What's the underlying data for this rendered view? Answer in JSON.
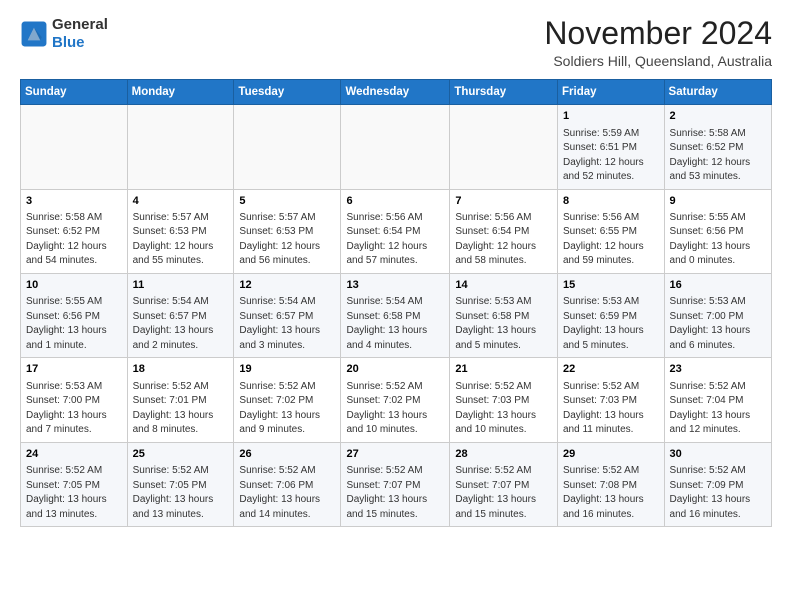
{
  "header": {
    "logo_line1": "General",
    "logo_line2": "Blue",
    "title": "November 2024",
    "subtitle": "Soldiers Hill, Queensland, Australia"
  },
  "weekdays": [
    "Sunday",
    "Monday",
    "Tuesday",
    "Wednesday",
    "Thursday",
    "Friday",
    "Saturday"
  ],
  "weeks": [
    [
      {
        "day": "",
        "info": ""
      },
      {
        "day": "",
        "info": ""
      },
      {
        "day": "",
        "info": ""
      },
      {
        "day": "",
        "info": ""
      },
      {
        "day": "",
        "info": ""
      },
      {
        "day": "1",
        "info": "Sunrise: 5:59 AM\nSunset: 6:51 PM\nDaylight: 12 hours\nand 52 minutes."
      },
      {
        "day": "2",
        "info": "Sunrise: 5:58 AM\nSunset: 6:52 PM\nDaylight: 12 hours\nand 53 minutes."
      }
    ],
    [
      {
        "day": "3",
        "info": "Sunrise: 5:58 AM\nSunset: 6:52 PM\nDaylight: 12 hours\nand 54 minutes."
      },
      {
        "day": "4",
        "info": "Sunrise: 5:57 AM\nSunset: 6:53 PM\nDaylight: 12 hours\nand 55 minutes."
      },
      {
        "day": "5",
        "info": "Sunrise: 5:57 AM\nSunset: 6:53 PM\nDaylight: 12 hours\nand 56 minutes."
      },
      {
        "day": "6",
        "info": "Sunrise: 5:56 AM\nSunset: 6:54 PM\nDaylight: 12 hours\nand 57 minutes."
      },
      {
        "day": "7",
        "info": "Sunrise: 5:56 AM\nSunset: 6:54 PM\nDaylight: 12 hours\nand 58 minutes."
      },
      {
        "day": "8",
        "info": "Sunrise: 5:56 AM\nSunset: 6:55 PM\nDaylight: 12 hours\nand 59 minutes."
      },
      {
        "day": "9",
        "info": "Sunrise: 5:55 AM\nSunset: 6:56 PM\nDaylight: 13 hours\nand 0 minutes."
      }
    ],
    [
      {
        "day": "10",
        "info": "Sunrise: 5:55 AM\nSunset: 6:56 PM\nDaylight: 13 hours\nand 1 minute."
      },
      {
        "day": "11",
        "info": "Sunrise: 5:54 AM\nSunset: 6:57 PM\nDaylight: 13 hours\nand 2 minutes."
      },
      {
        "day": "12",
        "info": "Sunrise: 5:54 AM\nSunset: 6:57 PM\nDaylight: 13 hours\nand 3 minutes."
      },
      {
        "day": "13",
        "info": "Sunrise: 5:54 AM\nSunset: 6:58 PM\nDaylight: 13 hours\nand 4 minutes."
      },
      {
        "day": "14",
        "info": "Sunrise: 5:53 AM\nSunset: 6:58 PM\nDaylight: 13 hours\nand 5 minutes."
      },
      {
        "day": "15",
        "info": "Sunrise: 5:53 AM\nSunset: 6:59 PM\nDaylight: 13 hours\nand 5 minutes."
      },
      {
        "day": "16",
        "info": "Sunrise: 5:53 AM\nSunset: 7:00 PM\nDaylight: 13 hours\nand 6 minutes."
      }
    ],
    [
      {
        "day": "17",
        "info": "Sunrise: 5:53 AM\nSunset: 7:00 PM\nDaylight: 13 hours\nand 7 minutes."
      },
      {
        "day": "18",
        "info": "Sunrise: 5:52 AM\nSunset: 7:01 PM\nDaylight: 13 hours\nand 8 minutes."
      },
      {
        "day": "19",
        "info": "Sunrise: 5:52 AM\nSunset: 7:02 PM\nDaylight: 13 hours\nand 9 minutes."
      },
      {
        "day": "20",
        "info": "Sunrise: 5:52 AM\nSunset: 7:02 PM\nDaylight: 13 hours\nand 10 minutes."
      },
      {
        "day": "21",
        "info": "Sunrise: 5:52 AM\nSunset: 7:03 PM\nDaylight: 13 hours\nand 10 minutes."
      },
      {
        "day": "22",
        "info": "Sunrise: 5:52 AM\nSunset: 7:03 PM\nDaylight: 13 hours\nand 11 minutes."
      },
      {
        "day": "23",
        "info": "Sunrise: 5:52 AM\nSunset: 7:04 PM\nDaylight: 13 hours\nand 12 minutes."
      }
    ],
    [
      {
        "day": "24",
        "info": "Sunrise: 5:52 AM\nSunset: 7:05 PM\nDaylight: 13 hours\nand 13 minutes."
      },
      {
        "day": "25",
        "info": "Sunrise: 5:52 AM\nSunset: 7:05 PM\nDaylight: 13 hours\nand 13 minutes."
      },
      {
        "day": "26",
        "info": "Sunrise: 5:52 AM\nSunset: 7:06 PM\nDaylight: 13 hours\nand 14 minutes."
      },
      {
        "day": "27",
        "info": "Sunrise: 5:52 AM\nSunset: 7:07 PM\nDaylight: 13 hours\nand 15 minutes."
      },
      {
        "day": "28",
        "info": "Sunrise: 5:52 AM\nSunset: 7:07 PM\nDaylight: 13 hours\nand 15 minutes."
      },
      {
        "day": "29",
        "info": "Sunrise: 5:52 AM\nSunset: 7:08 PM\nDaylight: 13 hours\nand 16 minutes."
      },
      {
        "day": "30",
        "info": "Sunrise: 5:52 AM\nSunset: 7:09 PM\nDaylight: 13 hours\nand 16 minutes."
      }
    ]
  ]
}
